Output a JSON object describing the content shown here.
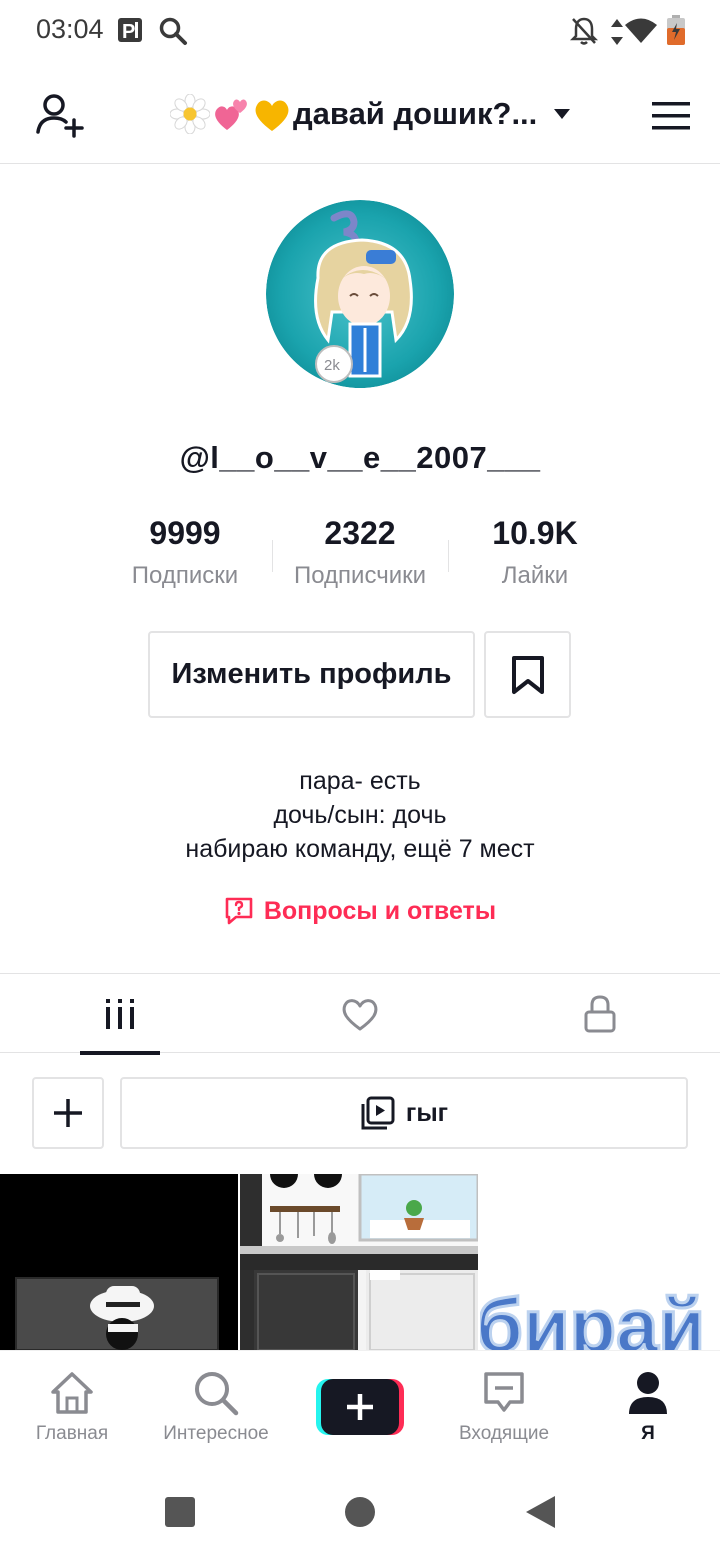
{
  "status_bar": {
    "time": "03:04"
  },
  "header": {
    "profile_name": "давай дошик?...",
    "emojis": [
      "daisy-emoji",
      "two-hearts-emoji",
      "yellow-heart-emoji"
    ]
  },
  "profile": {
    "avatar_badge": "2k",
    "username": "@l__o__v__e__2007___",
    "stats": [
      {
        "value": "9999",
        "label": "Подписки"
      },
      {
        "value": "2322",
        "label": "Подписчики"
      },
      {
        "value": "10.9K",
        "label": "Лайки"
      }
    ],
    "edit_button": "Изменить профиль",
    "bio_lines": [
      "пара- есть",
      "дочь/сын: дочь",
      "набираю команду, ещё 7 мест"
    ],
    "qa_link": "Вопросы и ответы"
  },
  "playlist": {
    "name": "гыг"
  },
  "grid": {
    "thumb3_text": "бирай"
  },
  "bottom_nav": {
    "items": [
      {
        "label": "Главная",
        "icon": "home-icon"
      },
      {
        "label": "Интересное",
        "icon": "search-icon"
      },
      {
        "label": "",
        "icon": "create-icon"
      },
      {
        "label": "Входящие",
        "icon": "inbox-icon"
      },
      {
        "label": "Я",
        "icon": "profile-icon"
      }
    ]
  },
  "colors": {
    "accent": "#fe2c55",
    "text_primary": "#161823",
    "text_secondary": "#8a8b91",
    "border": "#e3e3e4"
  }
}
